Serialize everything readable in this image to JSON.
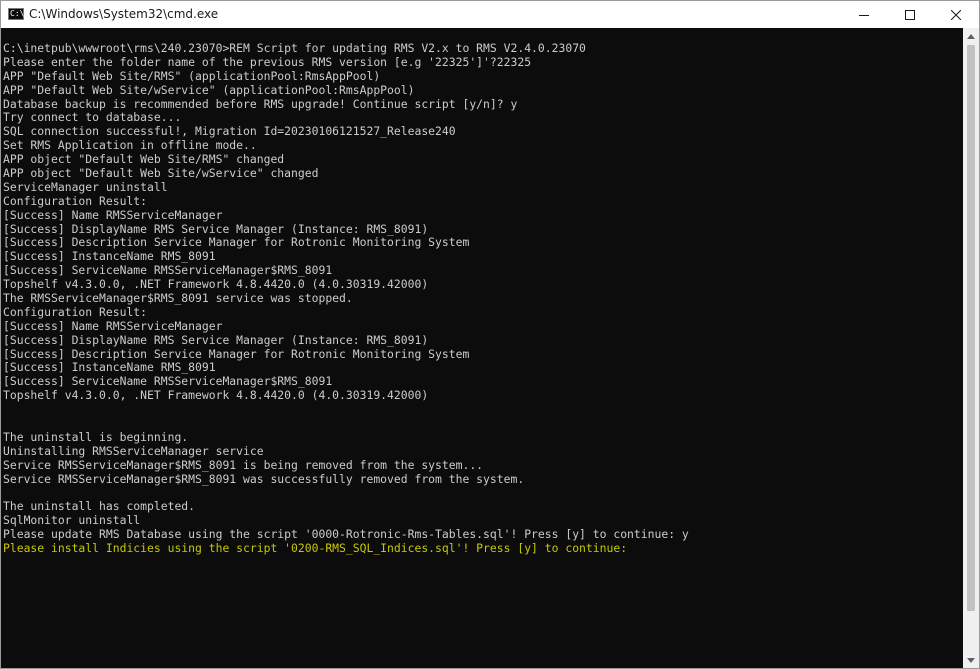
{
  "window": {
    "title": "C:\\Windows\\System32\\cmd.exe",
    "icon": "cmd-icon",
    "icon_glyph": "C:\\"
  },
  "controls": {
    "minimize_icon": "minimize-icon",
    "maximize_icon": "maximize-icon",
    "close_icon": "close-icon"
  },
  "colors": {
    "console_background": "#0c0c0c",
    "console_text": "#cccccc",
    "prompt_highlight": "#c8c800"
  },
  "console": {
    "lines": [
      {
        "text": "C:\\inetpub\\wwwroot\\rms\\240.23070>REM Script for updating RMS V2.x to RMS V2.4.0.23070",
        "style": "normal"
      },
      {
        "text": "Please enter the folder name of the previous RMS version [e.g '22325']'?22325",
        "style": "normal"
      },
      {
        "text": "APP \"Default Web Site/RMS\" (applicationPool:RmsAppPool)",
        "style": "normal"
      },
      {
        "text": "APP \"Default Web Site/wService\" (applicationPool:RmsAppPool)",
        "style": "normal"
      },
      {
        "text": "Database backup is recommended before RMS upgrade! Continue script [y/n]? y",
        "style": "normal"
      },
      {
        "text": "Try connect to database...",
        "style": "normal"
      },
      {
        "text": "SQL connection successful!, Migration Id=20230106121527_Release240",
        "style": "normal"
      },
      {
        "text": "Set RMS Application in offline mode..",
        "style": "normal"
      },
      {
        "text": "APP object \"Default Web Site/RMS\" changed",
        "style": "normal"
      },
      {
        "text": "APP object \"Default Web Site/wService\" changed",
        "style": "normal"
      },
      {
        "text": "ServiceManager uninstall",
        "style": "normal"
      },
      {
        "text": "Configuration Result:",
        "style": "normal"
      },
      {
        "text": "[Success] Name RMSServiceManager",
        "style": "normal"
      },
      {
        "text": "[Success] DisplayName RMS Service Manager (Instance: RMS_8091)",
        "style": "normal"
      },
      {
        "text": "[Success] Description Service Manager for Rotronic Monitoring System",
        "style": "normal"
      },
      {
        "text": "[Success] InstanceName RMS_8091",
        "style": "normal"
      },
      {
        "text": "[Success] ServiceName RMSServiceManager$RMS_8091",
        "style": "normal"
      },
      {
        "text": "Topshelf v4.3.0.0, .NET Framework 4.8.4420.0 (4.0.30319.42000)",
        "style": "normal"
      },
      {
        "text": "The RMSServiceManager$RMS_8091 service was stopped.",
        "style": "normal"
      },
      {
        "text": "Configuration Result:",
        "style": "normal"
      },
      {
        "text": "[Success] Name RMSServiceManager",
        "style": "normal"
      },
      {
        "text": "[Success] DisplayName RMS Service Manager (Instance: RMS_8091)",
        "style": "normal"
      },
      {
        "text": "[Success] Description Service Manager for Rotronic Monitoring System",
        "style": "normal"
      },
      {
        "text": "[Success] InstanceName RMS_8091",
        "style": "normal"
      },
      {
        "text": "[Success] ServiceName RMSServiceManager$RMS_8091",
        "style": "normal"
      },
      {
        "text": "Topshelf v4.3.0.0, .NET Framework 4.8.4420.0 (4.0.30319.42000)",
        "style": "normal"
      },
      {
        "text": "",
        "style": "normal"
      },
      {
        "text": "",
        "style": "normal"
      },
      {
        "text": "The uninstall is beginning.",
        "style": "normal"
      },
      {
        "text": "Uninstalling RMSServiceManager service",
        "style": "normal"
      },
      {
        "text": "Service RMSServiceManager$RMS_8091 is being removed from the system...",
        "style": "normal"
      },
      {
        "text": "Service RMSServiceManager$RMS_8091 was successfully removed from the system.",
        "style": "normal"
      },
      {
        "text": "",
        "style": "normal"
      },
      {
        "text": "The uninstall has completed.",
        "style": "normal"
      },
      {
        "text": "SqlMonitor uninstall",
        "style": "normal"
      },
      {
        "text": "Please update RMS Database using the script '0000-Rotronic-Rms-Tables.sql'! Press [y] to continue: y",
        "style": "normal"
      },
      {
        "text": "Please install Indicies using the script '0200-RMS_SQL_Indices.sql'! Press [y] to continue:",
        "style": "yellow"
      }
    ]
  },
  "scrollbar": {
    "up_icon": "scroll-up-arrow-icon",
    "down_icon": "scroll-down-arrow-icon"
  }
}
